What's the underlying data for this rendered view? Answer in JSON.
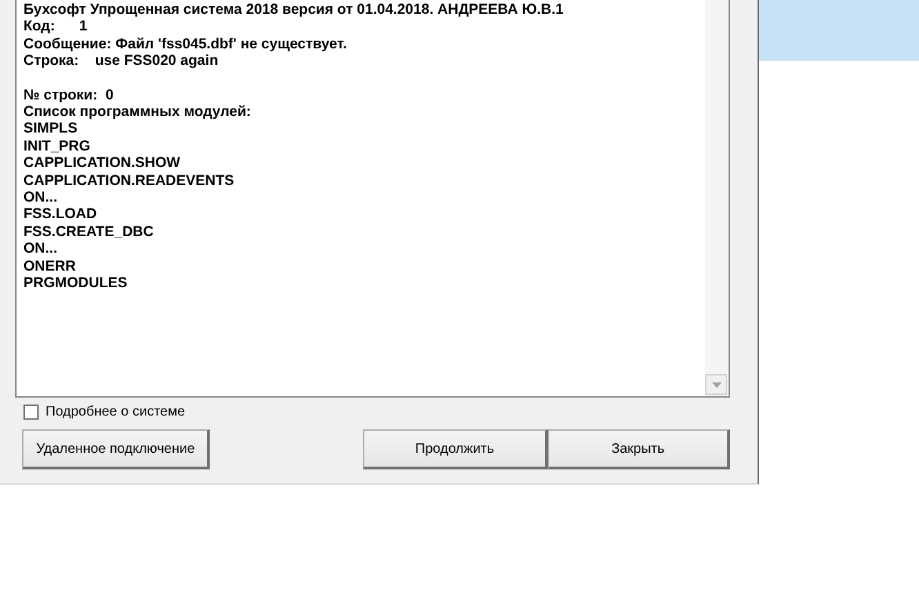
{
  "report": {
    "blocks": [
      [
        "Бухсофт Упрощенная система 2018 версия от 01.04.2018. АНДРЕЕВА Ю.В.1",
        "Код:      1",
        "Сообщение: Файл 'fss045.dbf' не существует.",
        "Строка:    use FSS020 again"
      ],
      [
        "№ строки:  0",
        "Список программных модулей:",
        "SIMPLS",
        "INIT_PRG",
        "CAPPLICATION.SHOW",
        "CAPPLICATION.READEVENTS",
        "ON...",
        "FSS.LOAD",
        "FSS.CREATE_DBC",
        "ON...",
        "ONERR",
        "PRGMODULES"
      ]
    ]
  },
  "details_checkbox": {
    "label": "Подробнее о системе",
    "checked": false
  },
  "buttons": {
    "remote": "Удаленное подключение",
    "continue": "Продолжить",
    "close": "Закрыть"
  }
}
